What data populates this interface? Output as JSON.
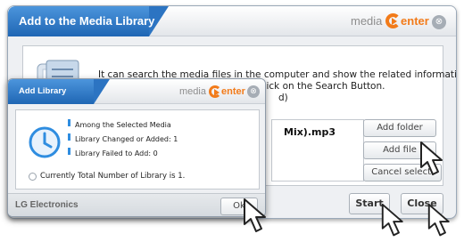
{
  "main_dialog": {
    "title": "Add to the Media Library",
    "brand_media": "media",
    "brand_center": "enter",
    "close_glyph": "⊗",
    "description_line1": "It can search the media files in the computer and show the related information.",
    "description_line2_visible": "Media, Click on the Search Button.",
    "description_line3_visible": "d)",
    "file_name": "Mix).mp3",
    "buttons": {
      "add_folder": "Add folder",
      "add_file": "Add file",
      "cancel_selection": "Cancel selecti",
      "start": "Start",
      "close": "Close"
    }
  },
  "add_library_popup": {
    "title": "Add Library",
    "brand_media": "media",
    "brand_center": "enter",
    "close_glyph": "⊗",
    "items": [
      "Among the Selected Media",
      "Library Changed or Added: 1",
      "Library Failed to Add: 0"
    ],
    "total": "Currently Total Number of Library is 1.",
    "footer": "LG Electronics",
    "ok": "Ok"
  },
  "colors": {
    "title_blue": "#1f66b4",
    "brand_orange": "#f27b1a"
  },
  "icons": [
    "media-library-icon",
    "clock-icon",
    "hand-cursor-icon",
    "close-icon"
  ]
}
